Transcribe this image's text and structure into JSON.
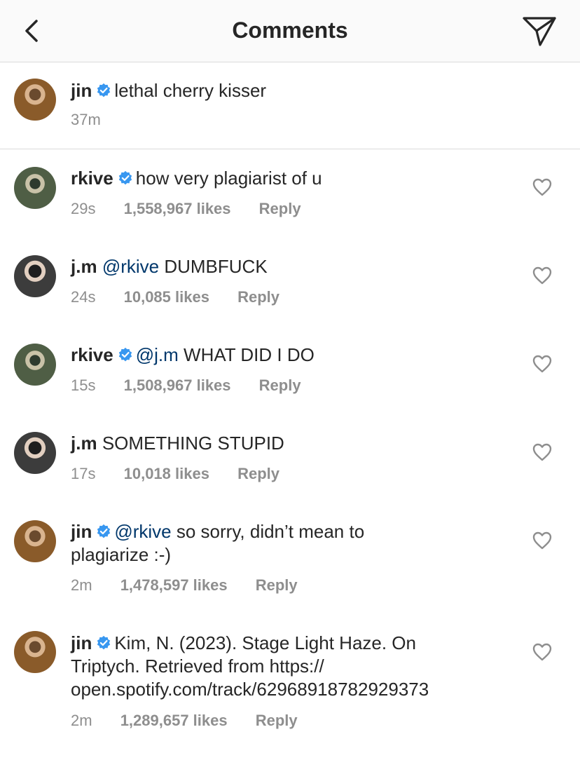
{
  "header": {
    "title": "Comments",
    "back_icon": "chevron-left-icon",
    "share_icon": "paper-plane-icon"
  },
  "caption": {
    "username": "jin",
    "verified": true,
    "text": "lethal cherry kisser",
    "time": "37m"
  },
  "comments": [
    {
      "username": "rkive",
      "verified": true,
      "mention": "",
      "text": "how very plagiarist of u",
      "line2": "",
      "line3": "",
      "time": "29s",
      "likes": "1,558,967 likes",
      "reply": "Reply"
    },
    {
      "username": "j.m",
      "verified": false,
      "mention": "@rkive",
      "text": "DUMBFUCK",
      "line2": "",
      "line3": "",
      "time": "24s",
      "likes": "10,085 likes",
      "reply": "Reply"
    },
    {
      "username": "rkive",
      "verified": true,
      "mention": "@j.m",
      "text": "WHAT DID I DO",
      "line2": "",
      "line3": "",
      "time": "15s",
      "likes": "1,508,967 likes",
      "reply": "Reply"
    },
    {
      "username": "j.m",
      "verified": false,
      "mention": "",
      "text": "SOMETHING STUPID",
      "line2": "",
      "line3": "",
      "time": "17s",
      "likes": "10,018 likes",
      "reply": "Reply"
    },
    {
      "username": "jin",
      "verified": true,
      "mention": "@rkive",
      "text": "so sorry, didn’t mean to",
      "line2": "plagiarize :-)",
      "line3": "",
      "time": "2m",
      "likes": "1,478,597 likes",
      "reply": "Reply"
    },
    {
      "username": "jin",
      "verified": true,
      "mention": "",
      "text": "Kim, N. (2023). Stage Light Haze. On",
      "line2": "Triptych. Retrieved from https://",
      "line3": "open.spotify.com/track/62968918782929373",
      "time": "2m",
      "likes": "1,289,657 likes",
      "reply": "Reply"
    }
  ],
  "colors": {
    "verified_badge": "#3897f0",
    "mention": "#00376b",
    "meta": "#8e8e8e"
  }
}
